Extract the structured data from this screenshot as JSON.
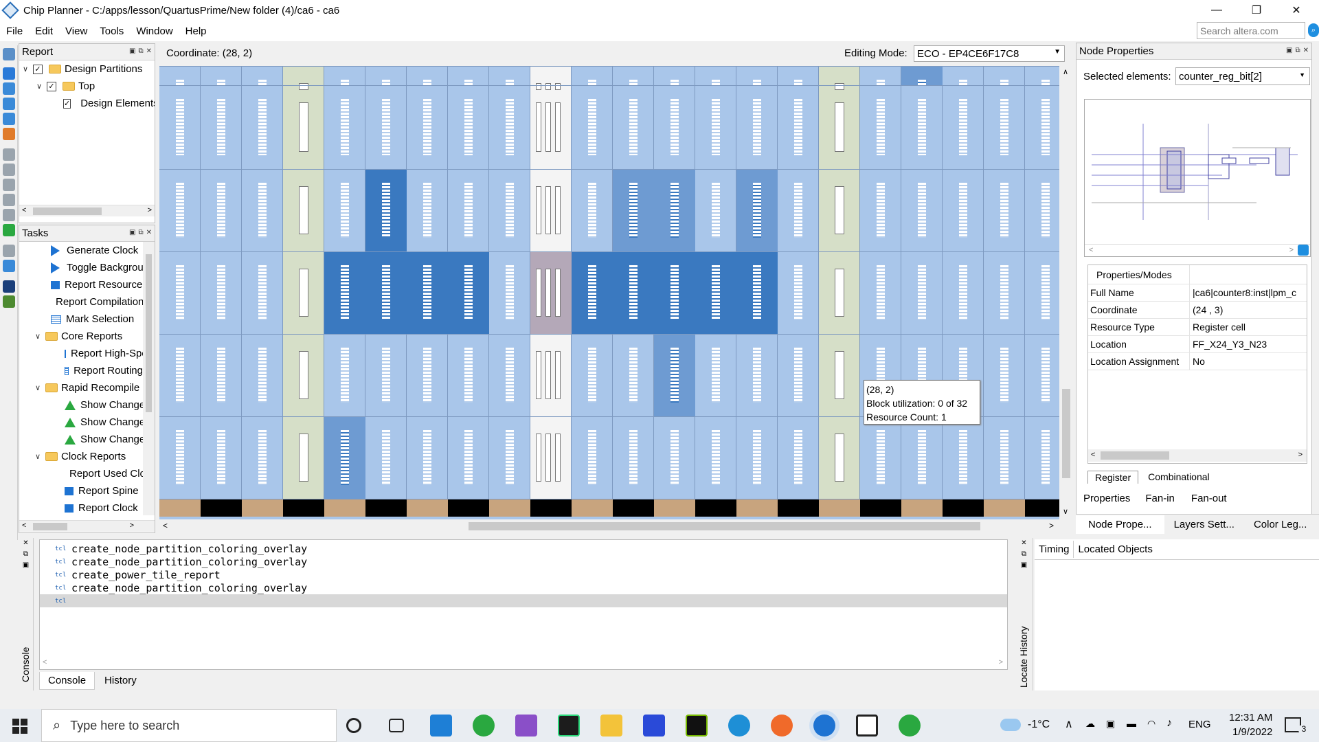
{
  "window": {
    "title": "Chip Planner - C:/apps/lesson/QuartusPrime/New folder (4)/ca6 - ca6",
    "minimize": "—",
    "restore": "❐",
    "close": "✕"
  },
  "menu": [
    "File",
    "Edit",
    "View",
    "Tools",
    "Window",
    "Help"
  ],
  "search": {
    "placeholder": "Search altera.com"
  },
  "report_panel": {
    "title": "Report",
    "items": [
      {
        "label": "Design Partitions",
        "level": 0
      },
      {
        "label": "Top",
        "level": 1
      },
      {
        "label": "Design Elements",
        "level": 2
      }
    ]
  },
  "tasks_panel": {
    "title": "Tasks",
    "items": [
      {
        "label": "Generate Clock",
        "icon": "play-icon"
      },
      {
        "label": "Toggle Background",
        "icon": "play-icon"
      },
      {
        "label": "Report Resource",
        "icon": "report-icon"
      },
      {
        "label": "Report Compilation",
        "icon": "report-icon"
      },
      {
        "label": "Mark Selection",
        "icon": "table-icon"
      },
      {
        "label": "Core Reports",
        "icon": "folder-icon"
      },
      {
        "label": "Report High-Speed",
        "icon": "table-icon"
      },
      {
        "label": "Report Routing",
        "icon": "table-icon"
      },
      {
        "label": "Rapid Recompile",
        "icon": "folder-icon"
      },
      {
        "label": "Show Changes",
        "icon": "triangle-icon"
      },
      {
        "label": "Show Changes",
        "icon": "triangle-icon"
      },
      {
        "label": "Show Changes",
        "icon": "triangle-icon"
      },
      {
        "label": "Clock Reports",
        "icon": "folder-icon"
      },
      {
        "label": "Report Used Clock",
        "icon": "report-icon"
      },
      {
        "label": "Report Spine",
        "icon": "report-icon"
      },
      {
        "label": "Report Clock",
        "icon": "report-icon"
      }
    ]
  },
  "chip_view": {
    "coordinate_label": "Coordinate: (28, 2)",
    "editing_mode_label": "Editing Mode:",
    "editing_mode_value": "ECO - EP4CE6F17C8",
    "tooltip": {
      "line1": "(28, 2)",
      "line2": "Block utilization: 0 of 32",
      "line3": "Resource Count: 1"
    }
  },
  "node_properties": {
    "title": "Node Properties",
    "selected_label": "Selected elements:",
    "selected_value": "counter_reg_bit[2]",
    "header": "Properties/Modes",
    "rows": [
      {
        "key": "Full Name",
        "value": "|ca6|counter8:inst|lpm_c"
      },
      {
        "key": "Coordinate",
        "value": "(24 , 3)"
      },
      {
        "key": "Resource Type",
        "value": "Register cell"
      },
      {
        "key": "Location",
        "value": "FF_X24_Y3_N23"
      },
      {
        "key": "Location Assignment",
        "value": "No"
      }
    ],
    "cell_tabs": [
      "Register",
      "Combinational"
    ],
    "bottom_tabs": [
      "Properties",
      "Fan-in",
      "Fan-out"
    ],
    "panel_tabs": [
      "Node Prope...",
      "Layers Sett...",
      "Color Leg..."
    ]
  },
  "console": {
    "side_label": "Console",
    "lines": [
      "create_node_partition_coloring_overlay",
      "create_node_partition_coloring_overlay",
      "create_power_tile_report",
      "create_node_partition_coloring_overlay"
    ],
    "tabs": [
      "Console",
      "History"
    ]
  },
  "locate_history": {
    "side_label": "Locate History",
    "tabs": [
      "Timing",
      "Located Objects"
    ]
  },
  "taskbar": {
    "search_placeholder": "Type here to search",
    "weather": "-1°C",
    "language": "ENG",
    "time": "12:31 AM",
    "date": "1/9/2022",
    "notification_count": "3"
  }
}
